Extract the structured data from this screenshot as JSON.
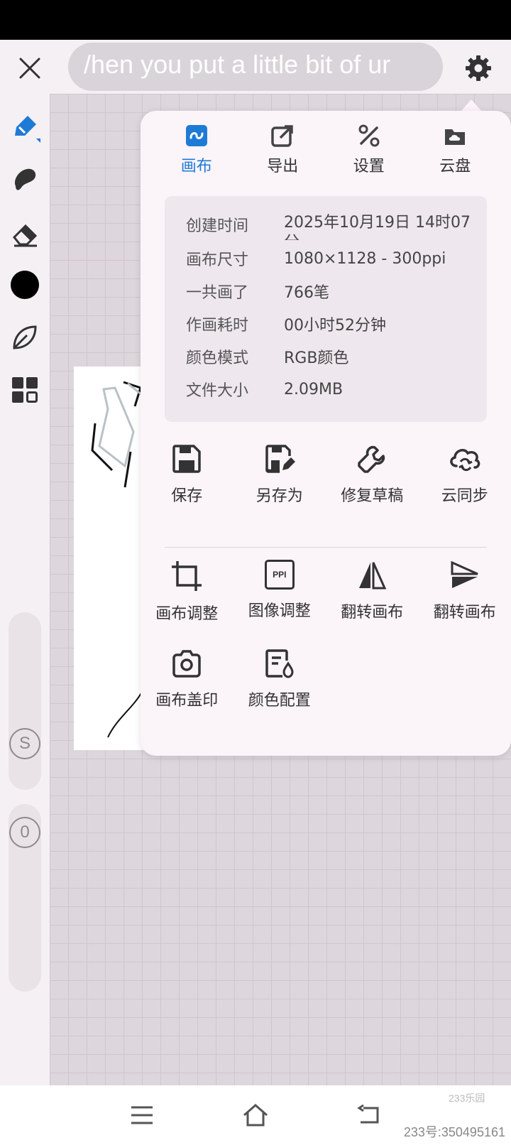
{
  "header": {
    "title": "/hen you put a little bit of ur"
  },
  "toolbar": {
    "slider_s_label": "S",
    "slider_o_label": "0"
  },
  "menu": {
    "tabs": [
      {
        "label": "画布",
        "icon": "canvas-icon",
        "active": true
      },
      {
        "label": "导出",
        "icon": "export-icon",
        "active": false
      },
      {
        "label": "设置",
        "icon": "settings-icon",
        "active": false
      },
      {
        "label": "云盘",
        "icon": "cloud-drive-icon",
        "active": false
      }
    ],
    "info": [
      {
        "key": "创建时间",
        "value": "2025年10月19日 14时07分"
      },
      {
        "key": "画布尺寸",
        "value": "1080×1128 - 300ppi"
      },
      {
        "key": "一共画了",
        "value": "766笔"
      },
      {
        "key": "作画耗时",
        "value": "00小时52分钟"
      },
      {
        "key": "颜色模式",
        "value": "RGB颜色"
      },
      {
        "key": "文件大小",
        "value": "2.09MB"
      }
    ],
    "file_actions": [
      {
        "label": "保存",
        "icon": "save-icon"
      },
      {
        "label": "另存为",
        "icon": "save-as-icon"
      },
      {
        "label": "修复草稿",
        "icon": "wrench-icon"
      },
      {
        "label": "云同步",
        "icon": "cloud-sync-icon"
      }
    ],
    "canvas_actions": [
      {
        "label": "画布调整",
        "icon": "crop-icon"
      },
      {
        "label": "图像调整",
        "icon": "ppi-icon",
        "icon_text": "PPI"
      },
      {
        "label": "翻转画布",
        "icon": "flip-horizontal-icon"
      },
      {
        "label": "翻转画布",
        "icon": "flip-vertical-icon"
      },
      {
        "label": "画布盖印",
        "icon": "camera-icon"
      },
      {
        "label": "颜色配置",
        "icon": "color-profile-icon"
      }
    ]
  },
  "colors": {
    "accent": "#1f7ad6",
    "panel_bg": "#fbf4f9",
    "info_bg": "#eee8ee",
    "current_color": "#000000"
  },
  "watermark": {
    "logo": "233乐园",
    "id_text": "233号:350495161"
  }
}
